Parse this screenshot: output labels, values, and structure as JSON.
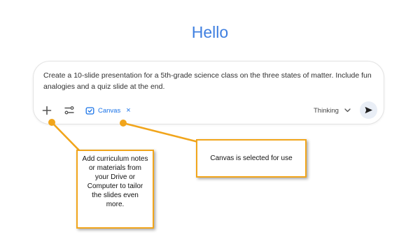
{
  "greeting": "Hello",
  "composer": {
    "prompt_text": "Create a 10-slide presentation for a 5th-grade science class on the three states of matter. Include fun analogies and a quiz slide at the end.",
    "add_icon": "plus-icon",
    "tools_icon": "tools-icon",
    "canvas_chip": {
      "label": "Canvas",
      "icon": "canvas-icon",
      "close_glyph": "×"
    },
    "mode_selector": {
      "label": "Thinking",
      "icon": "chevron-down-icon"
    },
    "send_icon": "send-icon"
  },
  "annotations": {
    "left_callout": "Add curriculum notes or materials from your Drive or Computer to tailor the slides even more.",
    "right_callout": "Canvas is selected for use"
  },
  "colors": {
    "greeting": "#3f7fe0",
    "accent": "#1a73e8",
    "callout_border": "#f1a51b",
    "send_button_bg": "#e9eef6"
  }
}
